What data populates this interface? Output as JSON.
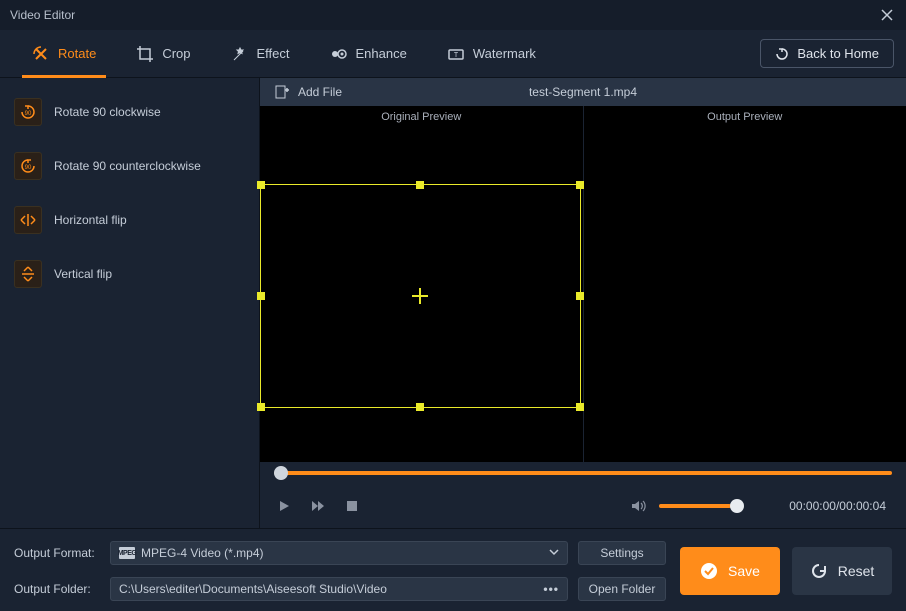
{
  "app": {
    "title": "Video Editor"
  },
  "toolbar": {
    "tabs": [
      {
        "label": "Rotate"
      },
      {
        "label": "Crop"
      },
      {
        "label": "Effect"
      },
      {
        "label": "Enhance"
      },
      {
        "label": "Watermark"
      }
    ],
    "back_home": "Back to Home"
  },
  "sidebar": {
    "items": [
      {
        "label": "Rotate 90 clockwise"
      },
      {
        "label": "Rotate 90 counterclockwise"
      },
      {
        "label": "Horizontal flip"
      },
      {
        "label": "Vertical flip"
      }
    ]
  },
  "filebar": {
    "add_file": "Add File",
    "filename": "test-Segment 1.mp4"
  },
  "preview": {
    "original": "Original Preview",
    "output": "Output Preview"
  },
  "controls": {
    "time": "00:00:00/00:00:04"
  },
  "bottom": {
    "output_format_label": "Output Format:",
    "output_format_value": "MPEG-4 Video (*.mp4)",
    "format_icon_text": "MPEG",
    "settings": "Settings",
    "output_folder_label": "Output Folder:",
    "output_folder_value": "C:\\Users\\editer\\Documents\\Aiseesoft Studio\\Video",
    "open_folder": "Open Folder",
    "save": "Save",
    "reset": "Reset"
  }
}
